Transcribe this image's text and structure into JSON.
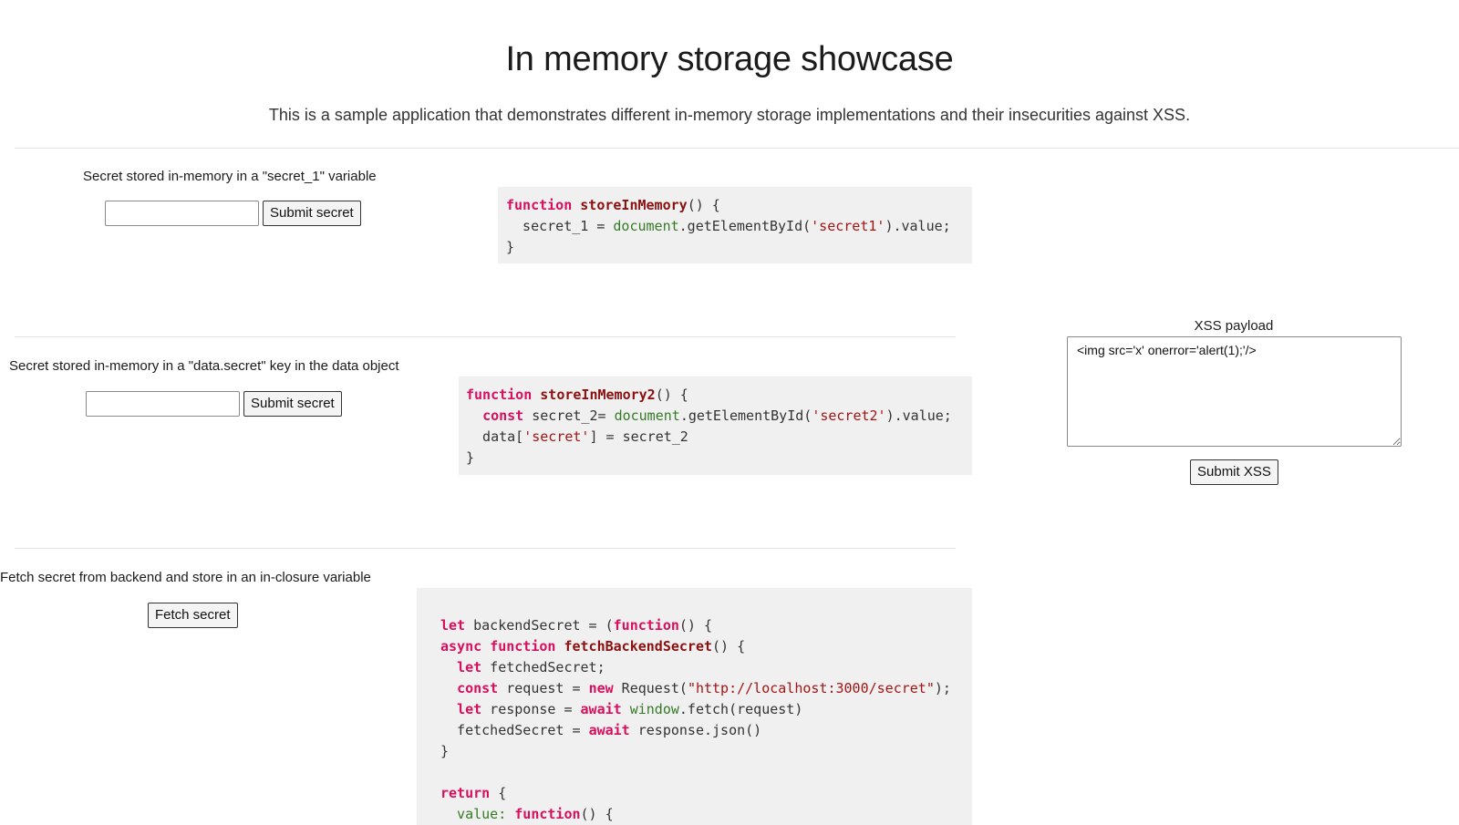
{
  "header": {
    "title": "In memory storage showcase",
    "subtitle": "This is a sample application that demonstrates different in-memory storage implementations and their insecurities against XSS."
  },
  "section1": {
    "label": "Secret stored in-memory in a \"secret_1\" variable",
    "input_value": "",
    "button_label": "Submit secret"
  },
  "section2": {
    "label": "Secret stored in-memory in a \"data.secret\" key in the data object",
    "input_value": "",
    "button_label": "Submit secret"
  },
  "section3": {
    "label": "Fetch secret from backend and store in an in-closure variable",
    "button_label": "Fetch secret"
  },
  "xss": {
    "label": "XSS payload",
    "payload": "<img src='x' onerror='alert(1);'/>",
    "button_label": "Submit XSS"
  },
  "code1": [
    [
      {
        "t": "function",
        "c": "kw"
      },
      {
        "t": " "
      },
      {
        "t": "storeInMemory",
        "c": "fn"
      },
      {
        "t": "() {"
      }
    ],
    [
      {
        "t": "  secret_1 = "
      },
      {
        "t": "document",
        "c": "glob"
      },
      {
        "t": ".getElementById("
      },
      {
        "t": "'secret1'",
        "c": "str"
      },
      {
        "t": ").value;"
      }
    ],
    [
      {
        "t": "}"
      }
    ]
  ],
  "code2": [
    [
      {
        "t": "function",
        "c": "kw"
      },
      {
        "t": " "
      },
      {
        "t": "storeInMemory2",
        "c": "fn"
      },
      {
        "t": "() {"
      }
    ],
    [
      {
        "t": "  "
      },
      {
        "t": "const",
        "c": "kw"
      },
      {
        "t": " secret_2= "
      },
      {
        "t": "document",
        "c": "glob"
      },
      {
        "t": ".getElementById("
      },
      {
        "t": "'secret2'",
        "c": "str"
      },
      {
        "t": ").value;"
      }
    ],
    [
      {
        "t": "  data["
      },
      {
        "t": "'secret'",
        "c": "str"
      },
      {
        "t": "] = secret_2"
      }
    ],
    [
      {
        "t": "}"
      }
    ]
  ],
  "code3": [
    [
      {
        "t": "let",
        "c": "kw"
      },
      {
        "t": " backendSecret = ("
      },
      {
        "t": "function",
        "c": "kw"
      },
      {
        "t": "() {"
      }
    ],
    [
      {
        "t": "async",
        "c": "kw"
      },
      {
        "t": " "
      },
      {
        "t": "function",
        "c": "kw"
      },
      {
        "t": " "
      },
      {
        "t": "fetchBackendSecret",
        "c": "fn"
      },
      {
        "t": "() {"
      }
    ],
    [
      {
        "t": "  "
      },
      {
        "t": "let",
        "c": "kw"
      },
      {
        "t": " fetchedSecret;"
      }
    ],
    [
      {
        "t": "  "
      },
      {
        "t": "const",
        "c": "kw"
      },
      {
        "t": " request = "
      },
      {
        "t": "new",
        "c": "kw"
      },
      {
        "t": " Request("
      },
      {
        "t": "\"http://localhost:3000/secret\"",
        "c": "str"
      },
      {
        "t": ");"
      }
    ],
    [
      {
        "t": "  "
      },
      {
        "t": "let",
        "c": "kw"
      },
      {
        "t": " response = "
      },
      {
        "t": "await",
        "c": "kw"
      },
      {
        "t": " "
      },
      {
        "t": "window",
        "c": "glob"
      },
      {
        "t": ".fetch(request)"
      }
    ],
    [
      {
        "t": "  fetchedSecret = "
      },
      {
        "t": "await",
        "c": "kw"
      },
      {
        "t": " response.json()"
      }
    ],
    [
      {
        "t": "}"
      }
    ],
    [
      {
        "t": ""
      }
    ],
    [
      {
        "t": "return",
        "c": "kw"
      },
      {
        "t": " {"
      }
    ],
    [
      {
        "t": "  value: ",
        "c": "glob"
      },
      {
        "t": "function",
        "c": "kw"
      },
      {
        "t": "() {"
      }
    ]
  ]
}
